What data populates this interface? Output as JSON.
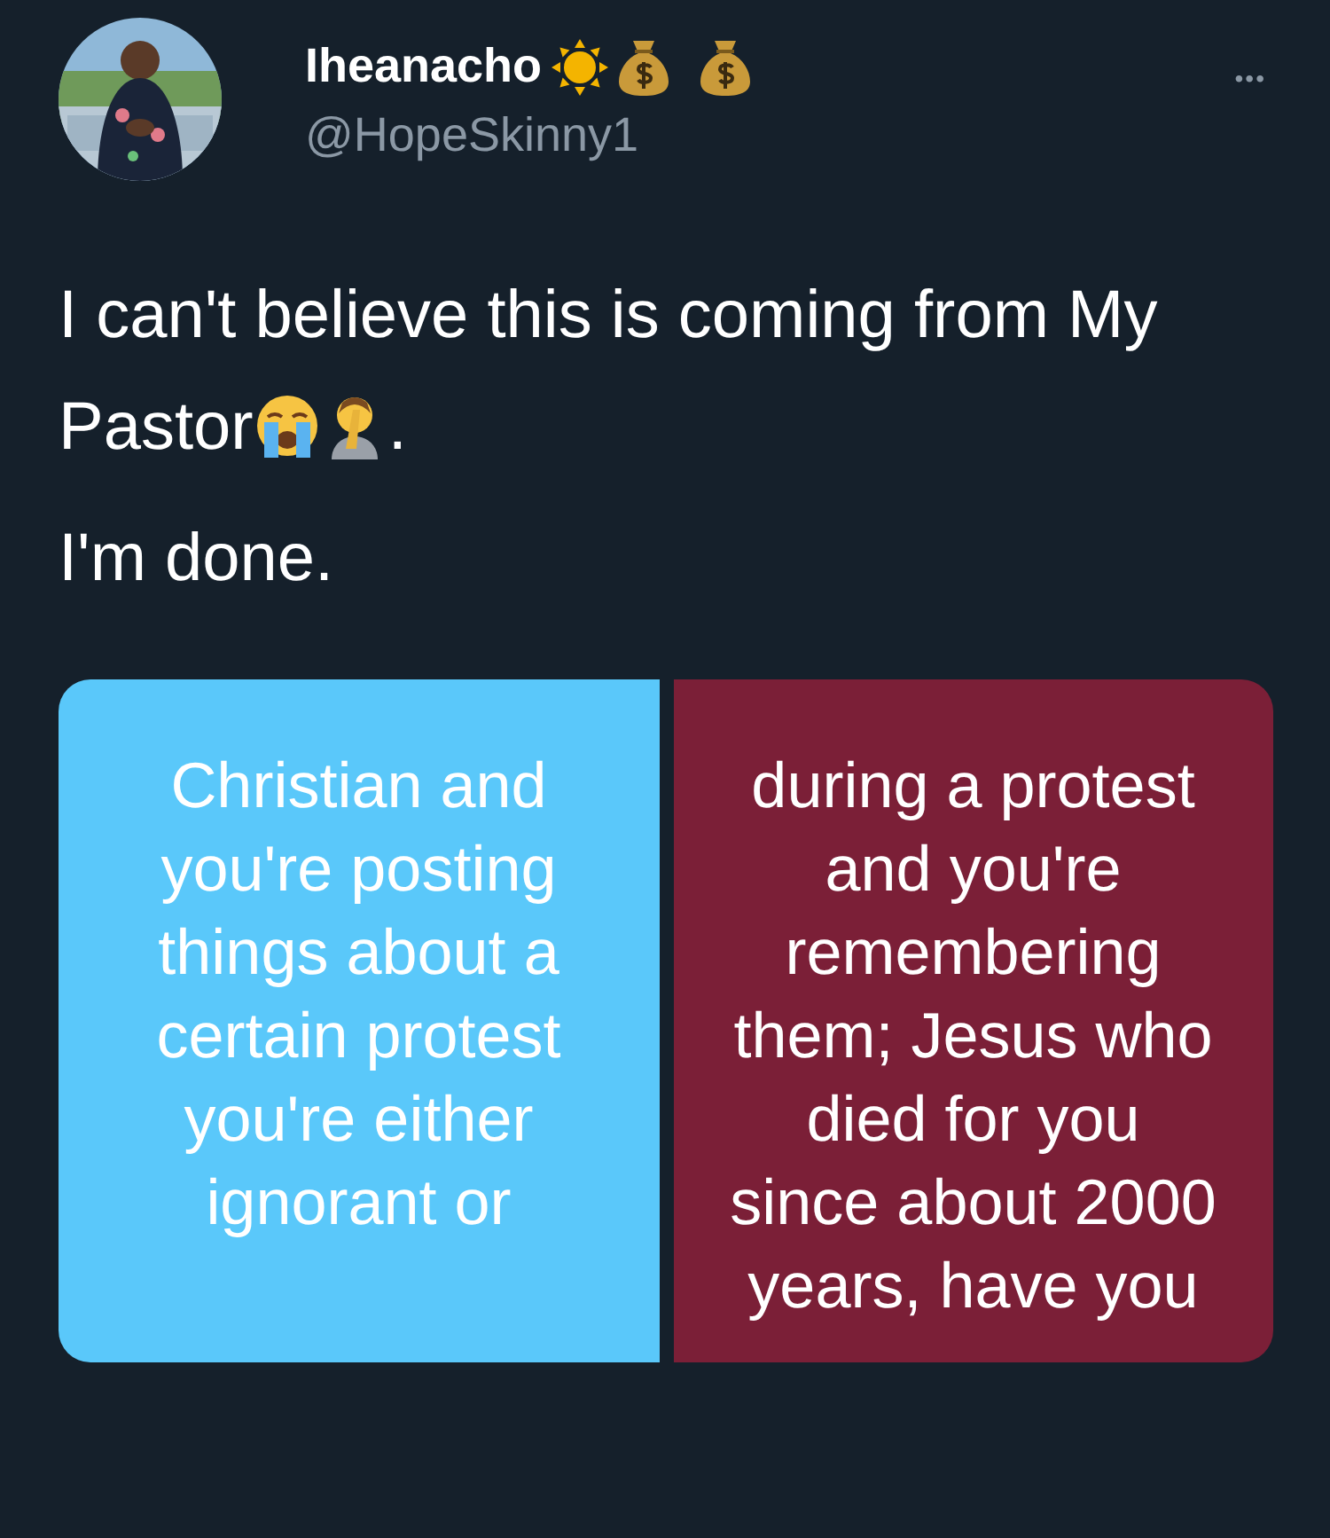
{
  "author": {
    "name": "Iheanacho",
    "handle": "@HopeSkinny1"
  },
  "more_button": "•••",
  "tweet": {
    "paragraphs": [
      {
        "text": "I can't believe this is coming from My Pastor",
        "trailing": "."
      },
      {
        "text": "I'm done."
      }
    ]
  },
  "media": [
    {
      "color": "#5ac8fa",
      "lines": [
        "Christian and",
        "you're posting",
        "things about a",
        "certain protest",
        "you're either",
        "ignorant or"
      ]
    },
    {
      "color": "#7b1f37",
      "lines": [
        "during a protest",
        "and you're",
        "remembering",
        "them; Jesus who",
        "died for you",
        "since about 2000",
        "years, have you"
      ]
    }
  ]
}
